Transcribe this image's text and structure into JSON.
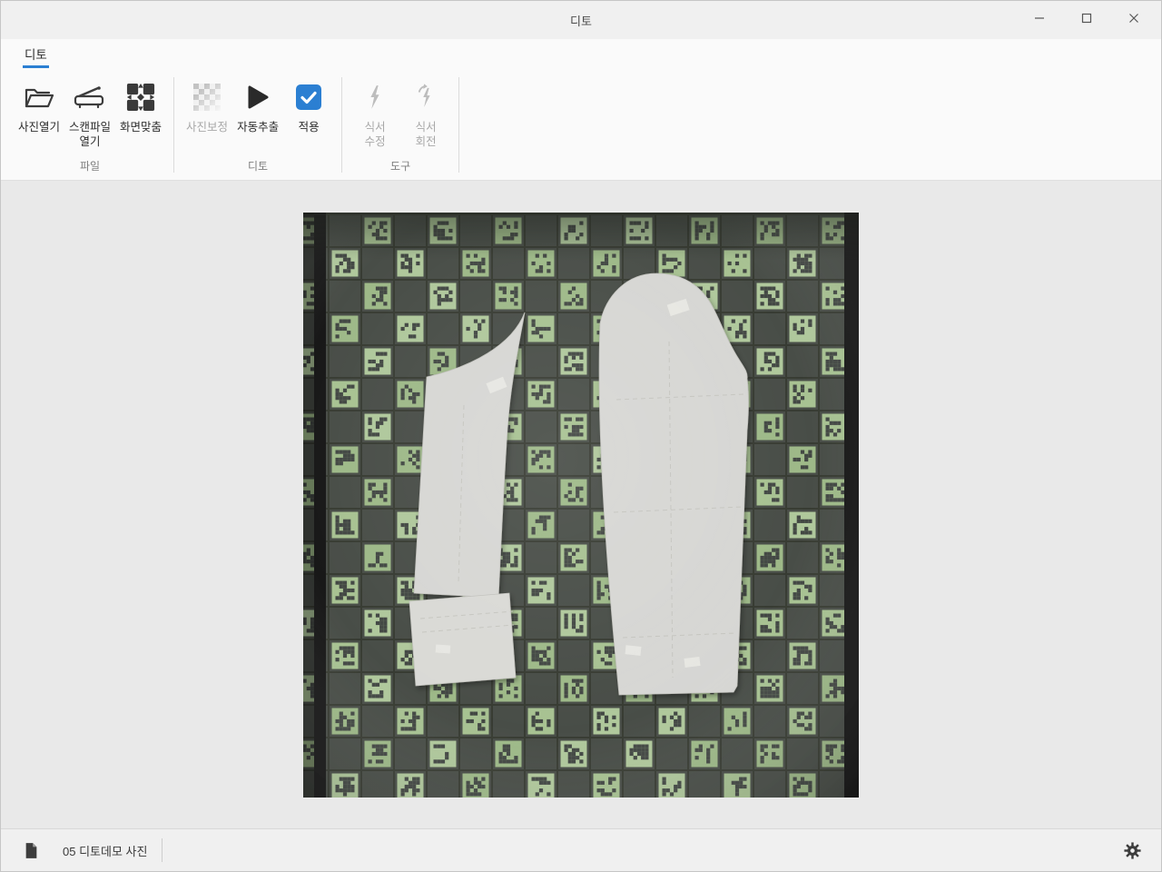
{
  "window": {
    "title": "디토"
  },
  "ribbon": {
    "tab": "디토",
    "groups": [
      {
        "label": "파일",
        "buttons": [
          {
            "label": "사진열기",
            "icon": "folder-icon",
            "enabled": true
          },
          {
            "label": "스캔파일\n열기",
            "icon": "scanner-icon",
            "enabled": true
          },
          {
            "label": "화면맞춤",
            "icon": "fit-screen-icon",
            "enabled": true
          }
        ]
      },
      {
        "label": "디토",
        "buttons": [
          {
            "label": "사진보정",
            "icon": "transparency-checker-icon",
            "enabled": false
          },
          {
            "label": "자동추출",
            "icon": "play-icon",
            "enabled": true
          },
          {
            "label": "적용",
            "icon": "check-icon",
            "enabled": true
          }
        ]
      },
      {
        "label": "도구",
        "buttons": [
          {
            "label": "식서\n수정",
            "icon": "grainline-edit-icon",
            "enabled": false
          },
          {
            "label": "식서\n회전",
            "icon": "grainline-rotate-icon",
            "enabled": false
          }
        ]
      }
    ]
  },
  "statusbar": {
    "file_label": "05 디토데모 사진"
  },
  "photo": {
    "description": "calibration marker board with two sewing pattern pieces"
  },
  "colors": {
    "accent": "#2b7fd2",
    "board_dark": "#3f4440",
    "marker_green": "#a6c190",
    "piece_gray": "#d6d6d3"
  }
}
